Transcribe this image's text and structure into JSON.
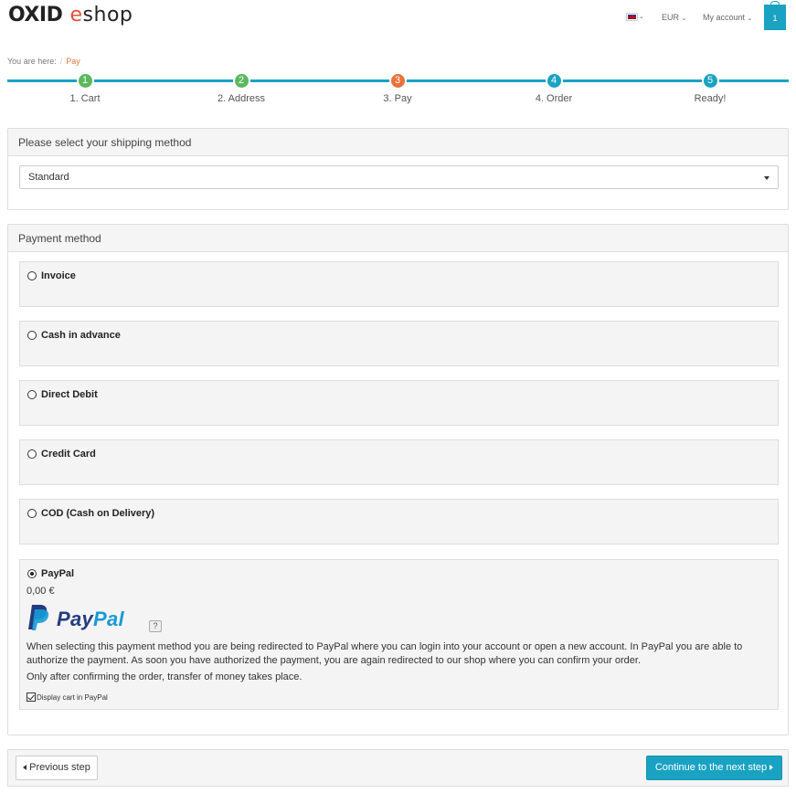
{
  "header": {
    "logo_oxid": "OXID",
    "logo_e": "e",
    "logo_shop": "shop",
    "currency": "EUR",
    "account": "My account",
    "cart_count": "1",
    "language_icon": "uk-flag-icon"
  },
  "breadcrumb": {
    "prefix": "You are here:",
    "separator": "/",
    "current": "Pay"
  },
  "steps": [
    {
      "number": "1",
      "label": "1. Cart"
    },
    {
      "number": "2",
      "label": "2. Address"
    },
    {
      "number": "3",
      "label": "3. Pay"
    },
    {
      "number": "4",
      "label": "4. Order"
    },
    {
      "number": "5",
      "label": "Ready!"
    }
  ],
  "colors": {
    "done": "#5cb85c",
    "active": "#e8733a",
    "pending": "#1aa2c2"
  },
  "shipping": {
    "heading": "Please select your shipping method",
    "selected": "Standard"
  },
  "payment": {
    "heading": "Payment method",
    "methods": [
      {
        "label": "Invoice",
        "checked": false
      },
      {
        "label": "Cash in advance",
        "checked": false
      },
      {
        "label": "Direct Debit",
        "checked": false
      },
      {
        "label": "Credit Card",
        "checked": false
      },
      {
        "label": "COD (Cash on Delivery)",
        "checked": false
      },
      {
        "label": "PayPal",
        "checked": true
      }
    ],
    "paypal": {
      "amount": "0,00 €",
      "logo_pay": "Pay",
      "logo_pal": "Pal",
      "help": "?",
      "description": "When selecting this payment method you are being redirected to PayPal where you can login into your account or open a new account. In PayPal you are able to authorize the payment. As soon you have authorized the payment, you are again redirected to our shop where you can confirm your order.",
      "note": "Only after confirming the order, transfer of money takes place.",
      "display_cart_label": "Display cart in PayPal",
      "display_cart_checked": true
    }
  },
  "nav": {
    "previous": "Previous step",
    "next": "Continue to the next step"
  }
}
